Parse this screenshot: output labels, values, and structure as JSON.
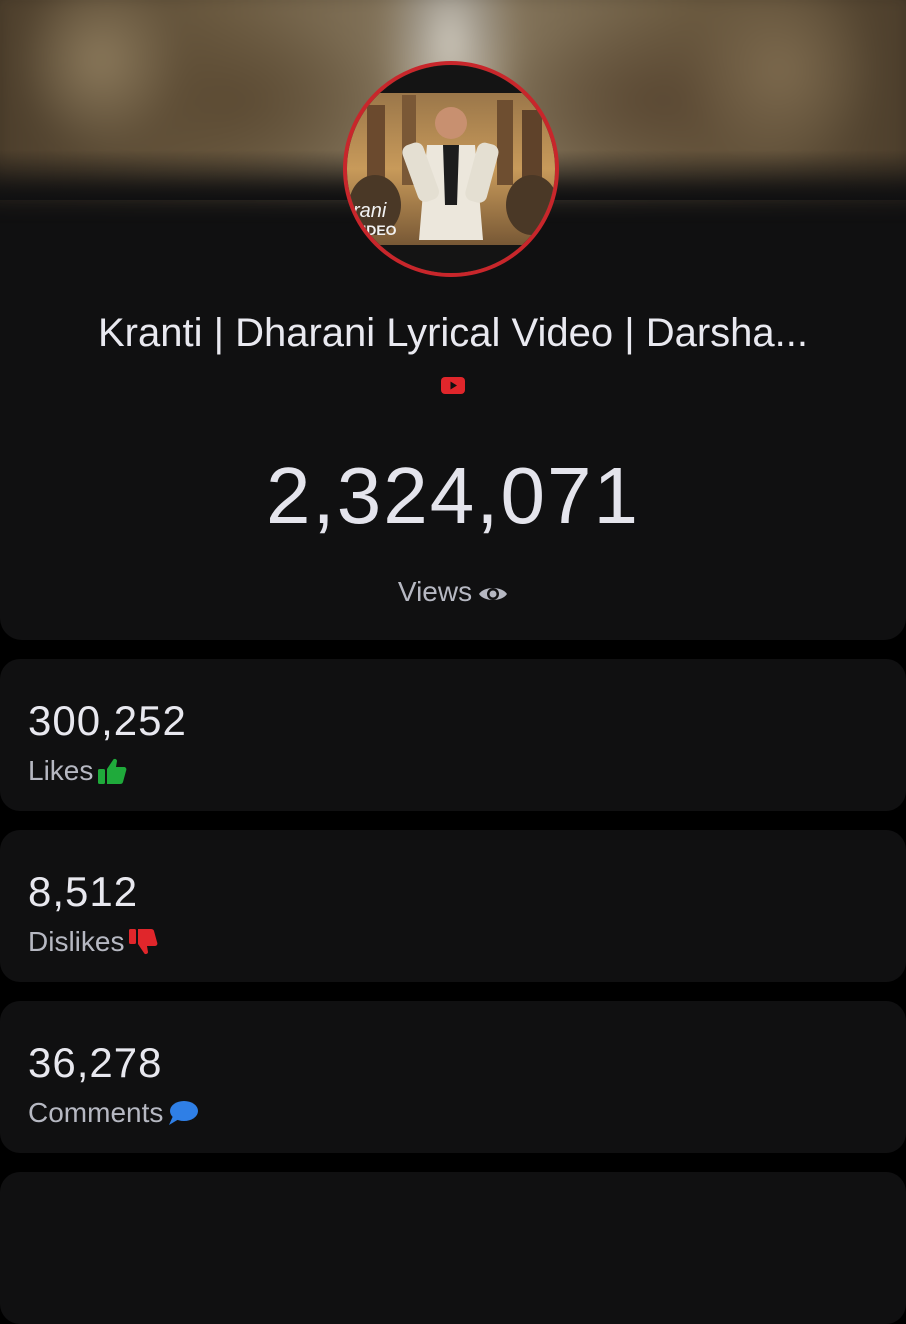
{
  "video": {
    "title": "Kranti | Dharani Lyrical Video | Darsha...",
    "platform_icon": "youtube-icon",
    "thumbnail_overlay_texts": [
      "rani",
      "VIDEO"
    ]
  },
  "views": {
    "count": "2,324,071",
    "label": "Views",
    "icon": "eye-icon"
  },
  "stats": [
    {
      "count": "300,252",
      "label": "Likes",
      "icon": "thumbs-up-icon",
      "color": "#1faa3b"
    },
    {
      "count": "8,512",
      "label": "Dislikes",
      "icon": "thumbs-down-icon",
      "color": "#e0262b"
    },
    {
      "count": "36,278",
      "label": "Comments",
      "icon": "comment-icon",
      "color": "#2f7fe6"
    }
  ],
  "colors": {
    "background": "#000000",
    "card": "#101011",
    "accent_ring": "#c8262b",
    "youtube_red": "#e0262b"
  }
}
